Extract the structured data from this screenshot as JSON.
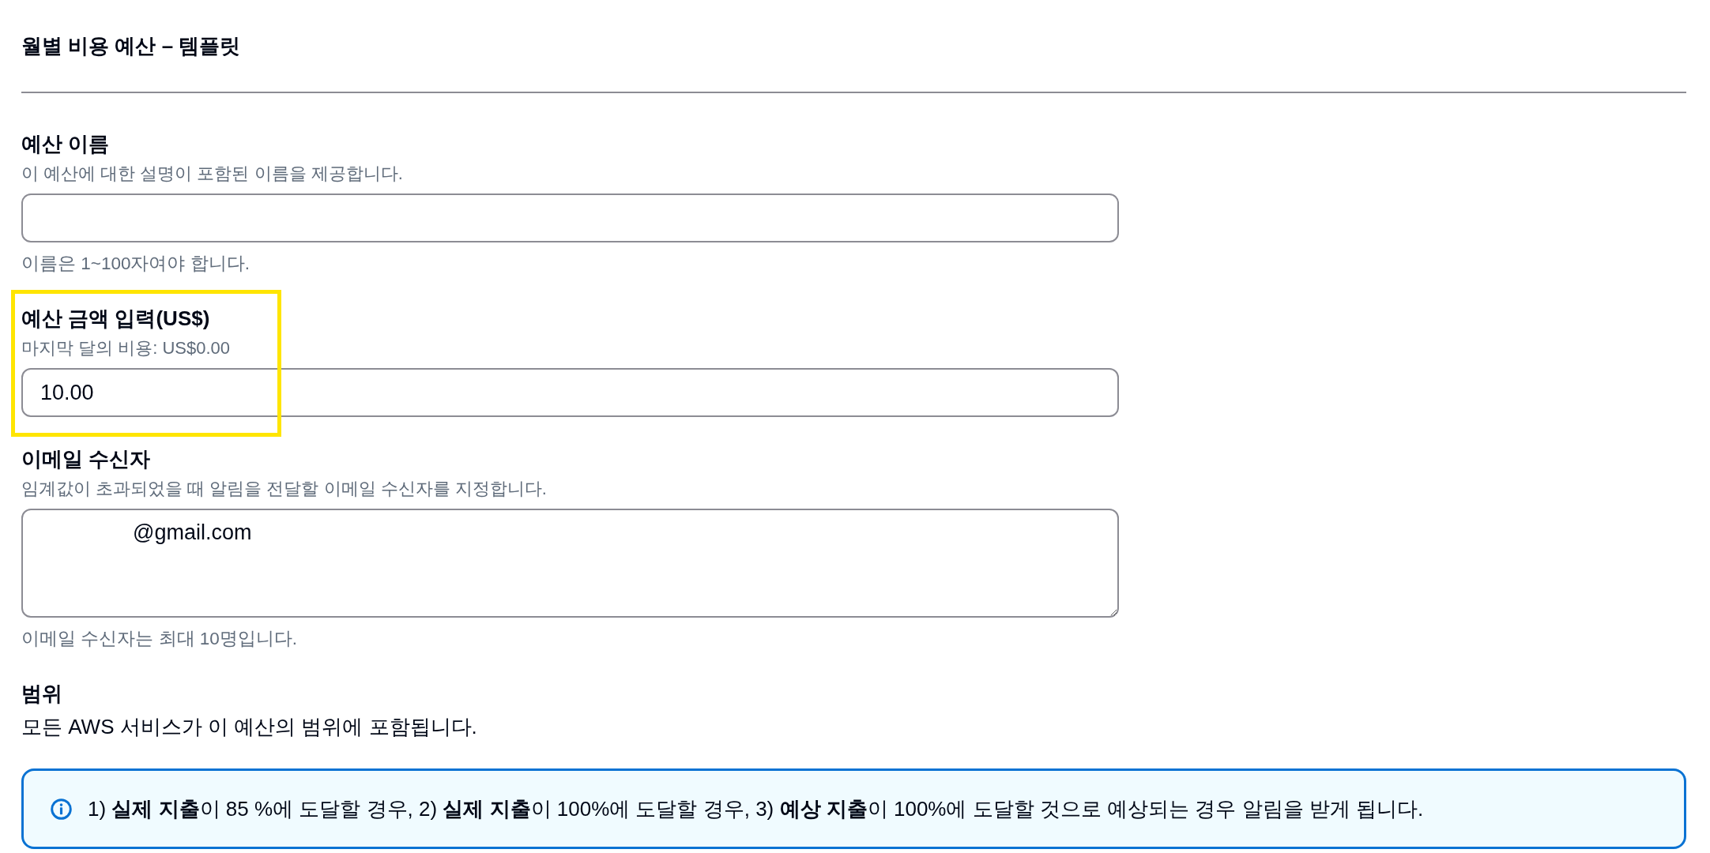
{
  "page": {
    "title": "월별 비용 예산 – 템플릿"
  },
  "fields": [
    {
      "kind": "input",
      "label": "예산 이름",
      "description": "이 예산에 대한 설명이 포함된 이름을 제공합니다.",
      "hint": "이름은 1~100자여야 합니다.",
      "highlighted": false
    },
    {
      "kind": "input",
      "label": "예산 금액 입력(US$)",
      "description": "마지막 달의 비용: US$0.00",
      "value": "10.00",
      "highlighted": true
    },
    {
      "kind": "textarea",
      "label": "이메일 수신자",
      "description": "임계값이 초과되었을 때 알림을 전달할 이메일 수신자를 지정합니다.",
      "value": "@gmail.com",
      "hint": "이메일 수신자는 최대 10명입니다.",
      "highlighted": false
    }
  ],
  "scope": {
    "heading": "범위",
    "text": "모든 AWS 서비스가 이 예산의 범위에 포함됩니다."
  },
  "alert": {
    "text": "1) **실제 지출**이 85 %에 도달할 경우, 2) **실제 지출**이 100%에 도달할 경우, 3) **예상 지출**이 100%에 도달할 것으로 예상되는 경우 알림을 받게 됩니다."
  }
}
